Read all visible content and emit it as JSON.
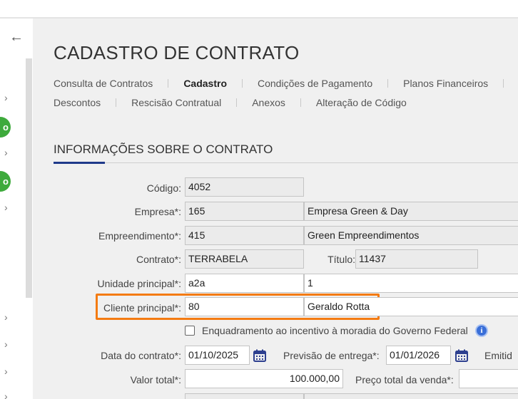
{
  "sidebar": {
    "back_icon": "←",
    "badges": [
      "o",
      "o"
    ],
    "chevron": "›"
  },
  "page": {
    "title": "CADASTRO DE CONTRATO"
  },
  "tabs": {
    "row1": [
      "Consulta de Contratos",
      "Cadastro",
      "Condições de Pagamento",
      "Planos Financeiros"
    ],
    "row2": [
      "Descontos",
      "Rescisão Contratual",
      "Anexos",
      "Alteração de Código"
    ],
    "active": "Cadastro"
  },
  "section": {
    "title": "INFORMAÇÕES SOBRE O CONTRATO"
  },
  "form": {
    "codigo": {
      "label": "Código:",
      "value": "4052"
    },
    "empresa": {
      "label": "Empresa*:",
      "code": "165",
      "name": "Empresa Green & Day"
    },
    "empreendimento": {
      "label": "Empreendimento*:",
      "code": "415",
      "name": "Green Empreendimentos"
    },
    "contrato": {
      "label": "Contrato*:",
      "value": "TERRABELA"
    },
    "titulo": {
      "label": "Título:",
      "value": "11437"
    },
    "unidade": {
      "label": "Unidade principal*:",
      "code": "a2a",
      "name": "1"
    },
    "cliente": {
      "label": "Cliente principal*:",
      "code": "80",
      "name": "Geraldo Rotta"
    },
    "enquadramento": {
      "label": "Enquadramento ao incentivo à moradia do Governo Federal",
      "checked": false
    },
    "data_contrato": {
      "label": "Data do contrato*:",
      "value": "01/10/2025"
    },
    "previsao_entrega": {
      "label": "Previsão de entrega*:",
      "value": "01/01/2026"
    },
    "emitido": {
      "label": "Emitid"
    },
    "valor_total": {
      "label": "Valor total*:",
      "value": "100.000,00"
    },
    "preco_total": {
      "label": "Preço total da venda*:",
      "value": ""
    }
  },
  "colors": {
    "highlight": "#f47b12",
    "accent": "#1f3a8a",
    "badge": "#3eaa3c"
  }
}
